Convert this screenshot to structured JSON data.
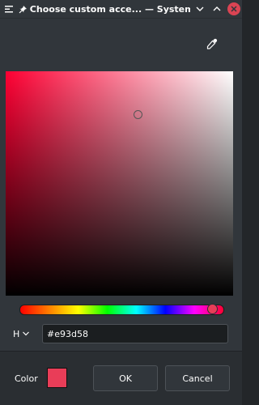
{
  "window": {
    "title": "Choose custom acce... — System Settings"
  },
  "icons": {
    "menu": "window-menu-icon",
    "pin": "pin-icon",
    "minimize": "chevron-down-icon",
    "maximize": "chevron-up-icon",
    "close": "close-icon",
    "picker": "eyedropper-icon"
  },
  "colors": {
    "selected": "#e93d58",
    "hue": "#ff0033",
    "close": "#da4453"
  },
  "picker": {
    "mode_label": "H",
    "hex_value": "#e93d58",
    "hue_fraction": 0.97
  },
  "footer": {
    "color_label": "Color",
    "ok_label": "OK",
    "cancel_label": "Cancel"
  }
}
